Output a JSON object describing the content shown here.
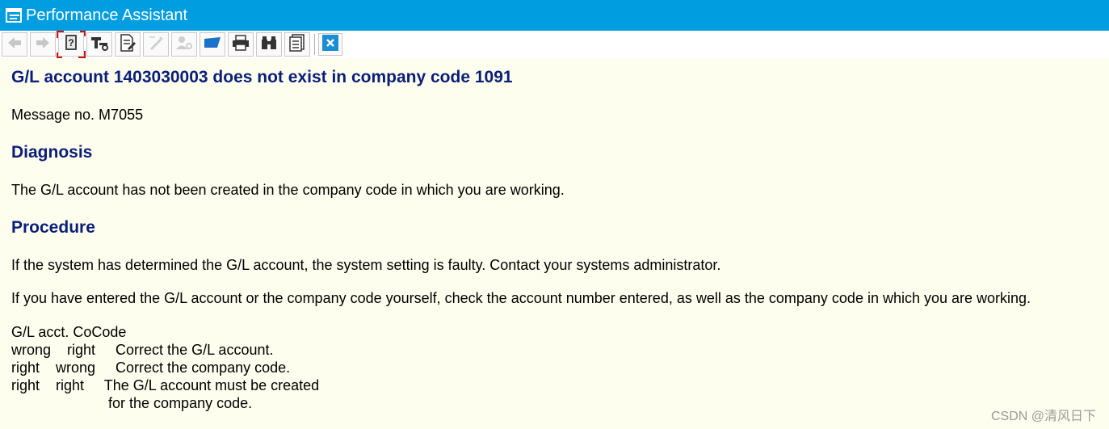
{
  "window": {
    "title": "Performance Assistant",
    "colors": {
      "titlebar": "#009de0",
      "content_bg": "#fefeef",
      "heading": "#0a1e78"
    }
  },
  "toolbar": {
    "buttons": [
      {
        "icon": "arrow-left-icon",
        "enabled": false
      },
      {
        "icon": "arrow-right-icon",
        "enabled": false
      },
      {
        "icon": "help-book-icon",
        "enabled": true,
        "selected": true
      },
      {
        "icon": "technical-info-icon",
        "enabled": true
      },
      {
        "icon": "edit-document-icon",
        "enabled": true
      },
      {
        "icon": "pencil-edit-icon",
        "enabled": false
      },
      {
        "icon": "user-settings-icon",
        "enabled": false
      },
      {
        "icon": "bookmark-tag-icon",
        "enabled": true
      },
      {
        "icon": "print-icon",
        "enabled": true
      },
      {
        "icon": "binoculars-find-icon",
        "enabled": true
      },
      {
        "icon": "document-list-icon",
        "enabled": true
      },
      {
        "icon": "close-icon",
        "enabled": true
      }
    ]
  },
  "content": {
    "heading": "G/L account 1403030003 does not exist in company code 1091",
    "message_no": "Message no. M7055",
    "diagnosis_heading": "Diagnosis",
    "diagnosis_text": "The G/L account has not been created in the company code in which you are working.",
    "procedure_heading": "Procedure",
    "procedure_text_1": "If the system has determined the G/L account, the system setting is faulty. Contact your systems administrator.",
    "procedure_text_2": "If you have entered the G/L account or the company code yourself, check the account number entered, as well as the company code in which you are working.",
    "table": {
      "header": "G/L acct. CoCode",
      "rows": [
        "wrong    right     Correct the G/L account.",
        "right    wrong     Correct the company code.",
        "right    right     The G/L account must be created",
        "                        for the company code."
      ]
    }
  },
  "watermark": "CSDN @清风日下"
}
